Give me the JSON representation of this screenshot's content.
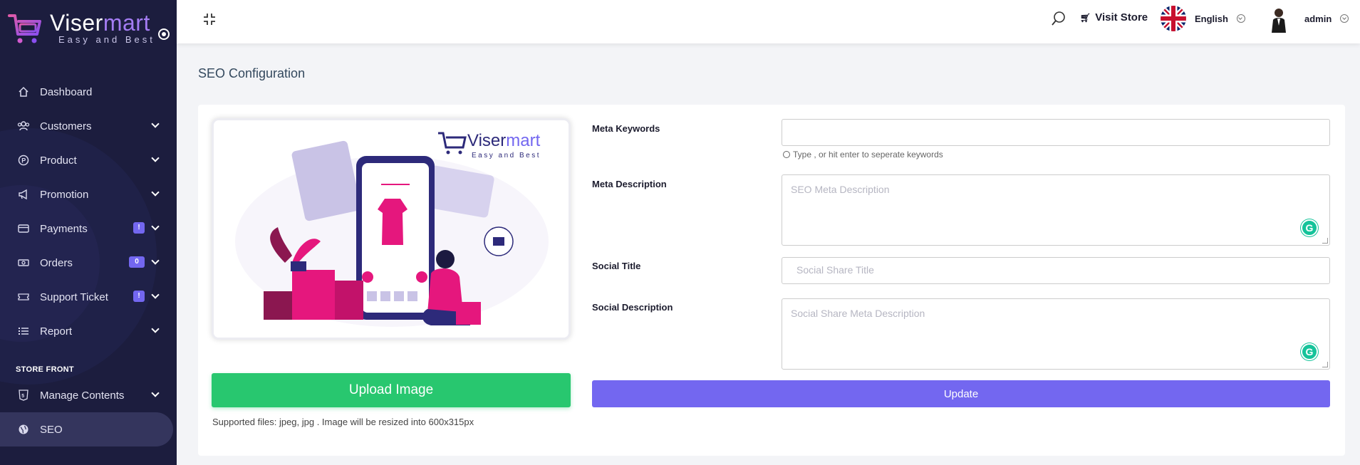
{
  "brand": {
    "name_part1": "Viser",
    "name_part2": "mart",
    "tagline": "Easy and Best",
    "accent": "#a47cf3"
  },
  "sidebar": {
    "items": [
      {
        "label": "Dashboard",
        "icon": "home-icon"
      },
      {
        "label": "Customers",
        "icon": "users-icon",
        "has_submenu": true
      },
      {
        "label": "Product",
        "icon": "product-icon",
        "has_submenu": true
      },
      {
        "label": "Promotion",
        "icon": "megaphone-icon",
        "has_submenu": true
      },
      {
        "label": "Payments",
        "icon": "credit-card-icon",
        "has_submenu": true,
        "badge": "!"
      },
      {
        "label": "Orders",
        "icon": "money-icon",
        "has_submenu": true,
        "badge": "0"
      },
      {
        "label": "Support Ticket",
        "icon": "ticket-icon",
        "has_submenu": true,
        "badge": "!"
      },
      {
        "label": "Report",
        "icon": "list-icon",
        "has_submenu": true
      }
    ],
    "section_label": "STORE FRONT",
    "store_items": [
      {
        "label": "Manage Contents",
        "icon": "html5-icon",
        "has_submenu": true
      },
      {
        "label": "SEO",
        "icon": "globe-icon",
        "active": true
      }
    ]
  },
  "topbar": {
    "visit_store": "Visit Store",
    "language": "English",
    "user": "admin"
  },
  "page": {
    "title": "SEO Configuration",
    "preview_brand_part1": "Viser",
    "preview_brand_part2": "mart",
    "preview_tagline": "Easy and Best",
    "upload_label": "Upload Image",
    "upload_hint": "Supported files: jpeg, jpg . Image will be resized into 600x315px",
    "meta_keywords_label": "Meta Keywords",
    "meta_keywords_value": "",
    "meta_keywords_hint": "Type , or hit enter to seperate keywords",
    "meta_description_label": "Meta Description",
    "meta_description_placeholder": "SEO Meta Description",
    "social_title_label": "Social Title",
    "social_title_placeholder": "Social Share Title",
    "social_description_label": "Social Description",
    "social_description_placeholder": "Social Share  Meta Description",
    "update_label": "Update"
  },
  "colors": {
    "sidebar_bg": "#1c1d3e",
    "primary": "#7367f0",
    "success": "#28c76f",
    "pink": "#e5177d"
  }
}
